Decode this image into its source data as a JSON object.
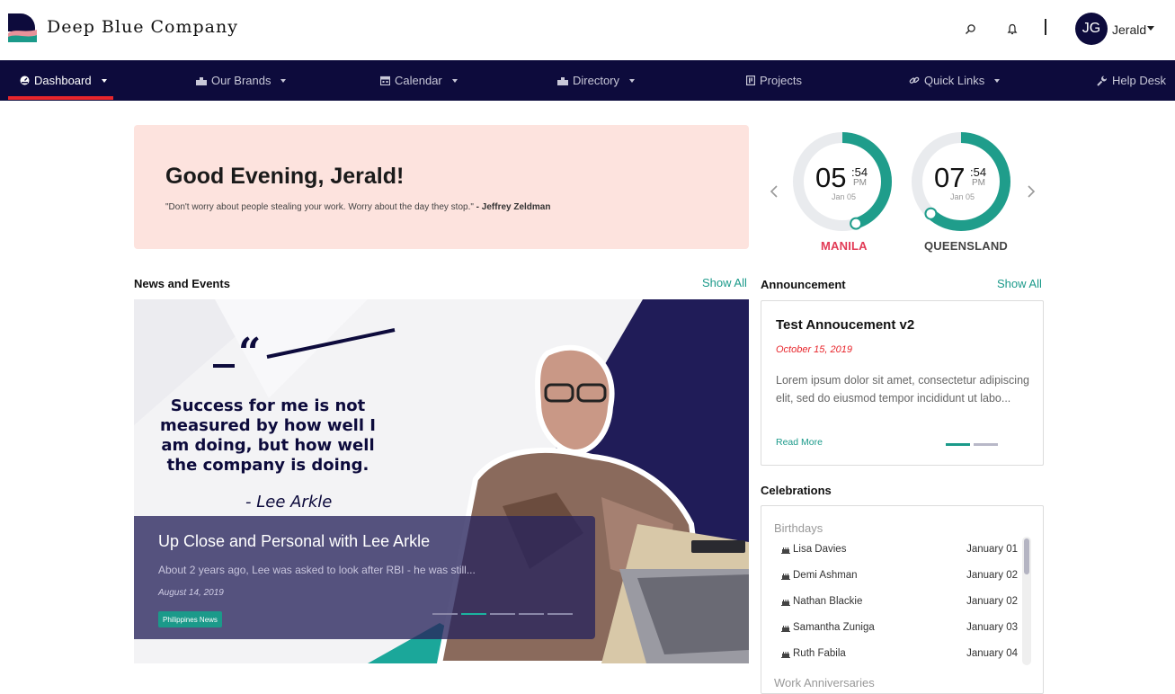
{
  "header": {
    "brand_name": "Deep Blue Company",
    "user_initials": "JG",
    "user_name": "Jerald"
  },
  "nav": {
    "items": [
      {
        "label": "Dashboard",
        "icon": "dashboard-icon",
        "active": true,
        "has_caret": true
      },
      {
        "label": "Our Brands",
        "icon": "brands-icon",
        "has_caret": true
      },
      {
        "label": "Calendar",
        "icon": "calendar-icon",
        "has_caret": true
      },
      {
        "label": "Directory",
        "icon": "directory-icon",
        "has_caret": true
      },
      {
        "label": "Projects",
        "icon": "projects-icon",
        "has_caret": false
      },
      {
        "label": "Quick Links",
        "icon": "link-icon",
        "has_caret": true
      },
      {
        "label": "Help Desk",
        "icon": "wrench-icon",
        "has_caret": false
      }
    ]
  },
  "greeting": {
    "title": "Good Evening, Jerald!",
    "quote": "\"Don't worry about people stealing your work. Worry about the day they stop.\"",
    "author": "- Jeffrey Zeldman"
  },
  "clocks": [
    {
      "hour": "05",
      "minute": ":54",
      "ampm": "PM",
      "date": "Jan 05",
      "city": "MANILA",
      "city_color": "#e23a55",
      "progress": 0.45
    },
    {
      "hour": "07",
      "minute": ":54",
      "ampm": "PM",
      "date": "Jan 05",
      "city": "QUEENSLAND",
      "city_color": "#444444",
      "progress": 0.62
    }
  ],
  "colors": {
    "navy": "#0d0b3c",
    "accent_teal": "#1b9a8a",
    "nav_active_underline": "#e8262c",
    "greeting_bg": "#fde3de"
  },
  "news": {
    "section_title": "News and Events",
    "show_all": "Show All",
    "image_quote_lines": [
      "Success for me is not",
      "measured by how well I",
      "am doing, but how well",
      "the company is doing."
    ],
    "image_quote_author": "- Lee Arkle",
    "title": "Up Close and Personal with Lee Arkle",
    "summary": "About 2 years ago, Lee was asked to look after RBI - he was still...",
    "date": "August 14, 2019",
    "tag": "Philippines News",
    "slide_count": 5,
    "active_slide": 2
  },
  "announcement": {
    "section_title": "Announcement",
    "show_all": "Show All",
    "title": "Test Annoucement v2",
    "date": "October 15, 2019",
    "body": "Lorem ipsum dolor sit amet, consectetur adipiscing elit, sed do eiusmod tempor incididunt ut labo...",
    "read_more": "Read More"
  },
  "celebrations": {
    "section_title": "Celebrations",
    "birthdays_label": "Birthdays",
    "birthdays": [
      {
        "name": "Lisa Davies",
        "date": "January 01"
      },
      {
        "name": "Demi Ashman",
        "date": "January 02"
      },
      {
        "name": "Nathan Blackie",
        "date": "January 02"
      },
      {
        "name": "Samantha Zuniga",
        "date": "January 03"
      },
      {
        "name": "Ruth Fabila",
        "date": "January 04"
      }
    ],
    "anniversaries_label": "Work Anniversaries"
  }
}
